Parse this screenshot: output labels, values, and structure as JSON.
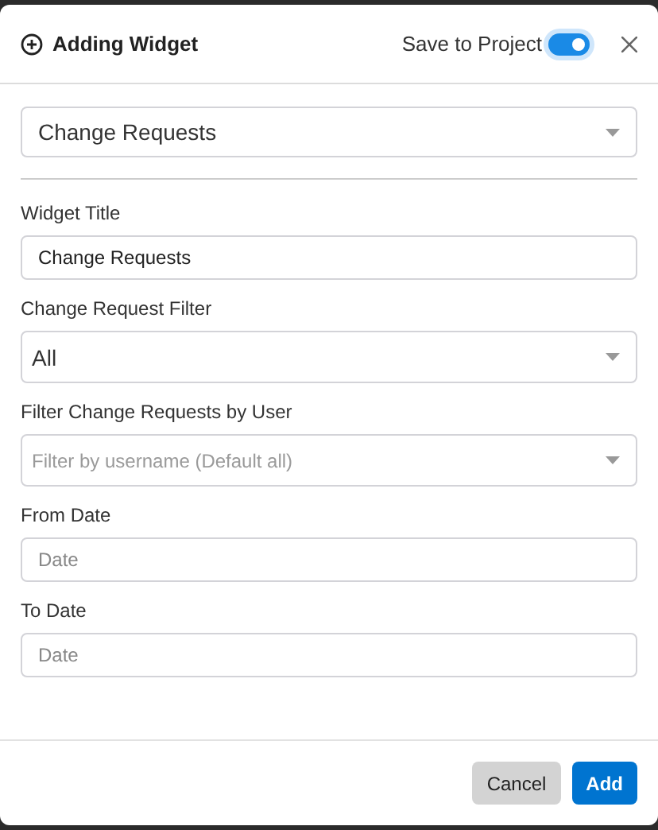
{
  "dialog": {
    "title": "Adding Widget",
    "save_to_project": {
      "label": "Save to Project",
      "on": true
    }
  },
  "widget_type": {
    "value": "Change Requests"
  },
  "fields": [
    {
      "kind": "text",
      "label": "Widget Title",
      "value": "Change Requests"
    },
    {
      "kind": "select",
      "label": "Change Request Filter",
      "value": "All"
    },
    {
      "kind": "select",
      "label": "Filter Change Requests by User",
      "placeholder": "Filter by username (Default all)"
    },
    {
      "kind": "text",
      "label": "From Date",
      "placeholder": "Date"
    },
    {
      "kind": "text",
      "label": "To Date",
      "placeholder": "Date"
    }
  ],
  "buttons": [
    {
      "kind": "secondary",
      "label": "Cancel"
    },
    {
      "kind": "primary",
      "label": "Add"
    }
  ]
}
